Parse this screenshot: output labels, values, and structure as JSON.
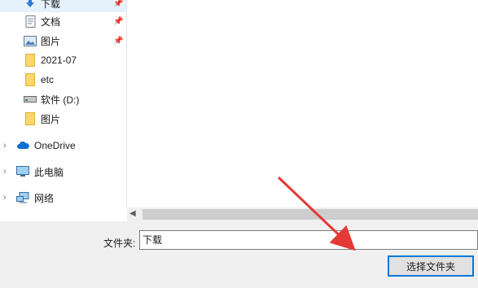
{
  "nav": {
    "quick_access": [
      {
        "label": "下载",
        "icon": "download-icon",
        "pinned": true
      },
      {
        "label": "文档",
        "icon": "document-icon",
        "pinned": true
      },
      {
        "label": "图片",
        "icon": "pictures-icon",
        "pinned": true
      },
      {
        "label": "2021-07",
        "icon": "folder-icon",
        "pinned": false
      },
      {
        "label": "etc",
        "icon": "folder-icon",
        "pinned": false
      },
      {
        "label": "软件 (D:)",
        "icon": "drive-icon",
        "pinned": false
      },
      {
        "label": "图片",
        "icon": "folder-icon",
        "pinned": false
      }
    ],
    "onedrive": {
      "label": "OneDrive",
      "icon": "cloud-icon"
    },
    "this_pc": {
      "label": "此电脑",
      "icon": "computer-icon"
    },
    "network": {
      "label": "网络",
      "icon": "network-icon"
    }
  },
  "footer": {
    "folder_label": "文件夹:",
    "folder_value": "下载",
    "select_button": "选择文件夹"
  },
  "colors": {
    "selected_bg": "#e5f1fb",
    "accent": "#0078d7",
    "annotation_arrow": "#e53935",
    "folder_yellow": "#ffd66b"
  }
}
